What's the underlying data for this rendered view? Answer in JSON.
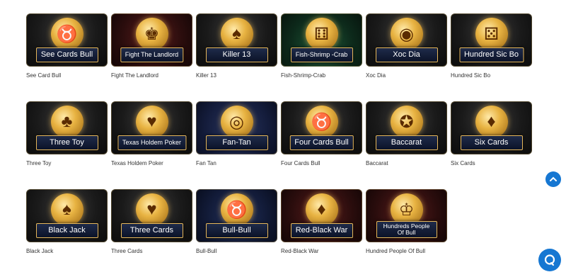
{
  "rows": [
    [
      {
        "plaque": "See Cards Bull",
        "caption": "See Card Bull",
        "icon": "bull-icon"
      },
      {
        "plaque": "Fight The Landlord",
        "caption": "Fight The Landlord",
        "icon": "landlord-icon"
      },
      {
        "plaque": "Killer 13",
        "caption": "Killer 13",
        "icon": "cards-icon"
      },
      {
        "plaque": "Fish-Shrimp -Crab",
        "caption": "Fish-Shrimp-Crab",
        "icon": "dice-icon"
      },
      {
        "plaque": "Xoc Dia",
        "caption": "Xoc Dia",
        "icon": "bowl-icon"
      },
      {
        "plaque": "Hundred Sic Bo",
        "caption": "Hundred Sic Bo",
        "icon": "dice-icon"
      }
    ],
    [
      {
        "plaque": "Three Toy",
        "caption": "Three Toy",
        "icon": "cards-icon"
      },
      {
        "plaque": "Texas Holdem Poker",
        "caption": "Texas Holdem Poker",
        "icon": "poker-icon"
      },
      {
        "plaque": "Fan-Tan",
        "caption": "Fan Tan",
        "icon": "chips-icon"
      },
      {
        "plaque": "Four Cards Bull",
        "caption": "Four Cards Bull",
        "icon": "bull-icon"
      },
      {
        "plaque": "Baccarat",
        "caption": "Baccarat",
        "icon": "roulette-icon"
      },
      {
        "plaque": "Six Cards",
        "caption": "Six Cards",
        "icon": "cat-icon"
      }
    ],
    [
      {
        "plaque": "Black Jack",
        "caption": "Black Jack",
        "icon": "top-hat-icon"
      },
      {
        "plaque": "Three Cards",
        "caption": "Three Cards",
        "icon": "cards-icon"
      },
      {
        "plaque": "Bull-Bull",
        "caption": "Bull-Bull",
        "icon": "bull-icon"
      },
      {
        "plaque": "Red-Black War",
        "caption": "Red-Black War",
        "icon": "cards-icon"
      },
      {
        "plaque": "Hundreds People Of Bull",
        "caption": "Hundred People Of Bull",
        "icon": "hat-icon"
      }
    ]
  ],
  "widgets": {
    "scroll_top_icon": "chevron-up-icon",
    "chat_icon": "chat-icon"
  },
  "colors": {
    "accent": "#1677d2",
    "plaque_border": "#e6b75a"
  }
}
